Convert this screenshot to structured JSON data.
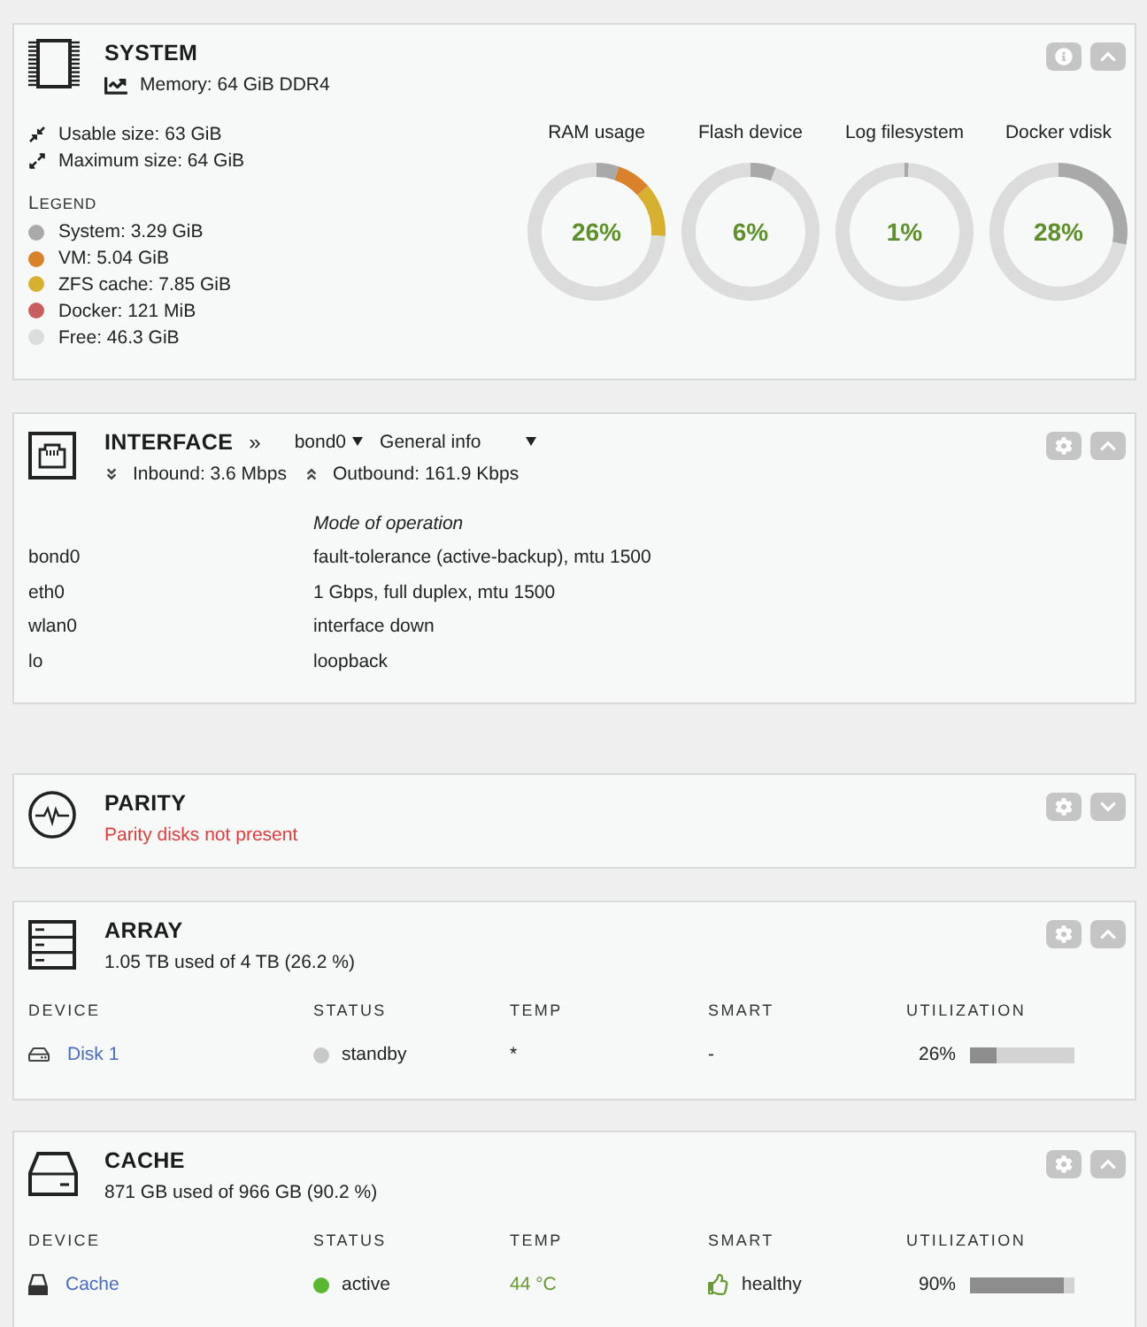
{
  "panels": [
    {
      "kind": "system",
      "title": "SYSTEM",
      "expanded": true,
      "memory": "Memory: 64 GiB DDR4",
      "sizes": [
        {
          "kind": "usable",
          "text": "Usable size: 63 GiB"
        },
        {
          "kind": "maximum",
          "text": "Maximum size: 64 GiB"
        }
      ],
      "legend": {
        "title": "LEGEND",
        "items": [
          {
            "label": "System: 3.29 GiB",
            "color": "#a9a9a9"
          },
          {
            "label": "VM: 5.04 GiB",
            "color": "#d9822b"
          },
          {
            "label": "ZFS cache: 7.85 GiB",
            "color": "#d6b02e"
          },
          {
            "label": "Docker: 121 MiB",
            "color": "#c85f5e"
          },
          {
            "label": "Free: 46.3 GiB",
            "color": "#dcdcdc"
          }
        ]
      },
      "gauges": [
        {
          "kind": "breakdown",
          "reading": "26%",
          "chart_data": {
            "type": "donut",
            "title": "RAM usage",
            "values": [
              5.3,
              8.1,
              12.6,
              74
            ]
          }
        },
        {
          "kind": "usage",
          "reading": "6%",
          "chart_data": {
            "type": "donut",
            "title": "Flash device",
            "values": [
              6,
              94
            ]
          }
        },
        {
          "kind": "usage",
          "reading": "1%",
          "chart_data": {
            "type": "donut",
            "title": "Log filesystem",
            "values": [
              1,
              99
            ]
          }
        },
        {
          "kind": "usage",
          "reading": "28%",
          "chart_data": {
            "type": "donut",
            "title": "Docker vdisk",
            "values": [
              28,
              72
            ]
          }
        }
      ]
    },
    {
      "kind": "interface",
      "title": "INTERFACE",
      "expanded": true,
      "separator": "»",
      "interface_select": "bond0",
      "view_select": "General info",
      "traffic": [
        {
          "kind": "inbound",
          "text": "Inbound: 3.6 Mbps"
        },
        {
          "kind": "outbound",
          "text": "Outbound: 161.9 Kbps"
        }
      ],
      "table": {
        "heading": "Mode of operation",
        "rows": [
          {
            "name": "bond0",
            "mode": "fault-tolerance (active-backup), mtu 1500"
          },
          {
            "name": "eth0",
            "mode": "1 Gbps, full duplex, mtu 1500"
          },
          {
            "name": "wlan0",
            "mode": "interface down"
          },
          {
            "name": "lo",
            "mode": "loopback"
          }
        ]
      }
    },
    {
      "kind": "parity",
      "title": "PARITY",
      "expanded": false,
      "status": "Parity disks not present"
    },
    {
      "kind": "array",
      "title": "ARRAY",
      "expanded": true,
      "usage": "1.05 TB used of 4 TB (26.2 %)",
      "table": {
        "columns": [
          "DEVICE",
          "STATUS",
          "TEMP",
          "SMART",
          "UTILIZATION"
        ],
        "rows": [
          {
            "device": {
              "name": "Disk 1",
              "kind": "hdd"
            },
            "status": {
              "text": "standby",
              "color": "#c8c8c8"
            },
            "temp": {
              "text": "*",
              "kind": "plain"
            },
            "smart": {
              "text": "-",
              "kind": "plain"
            },
            "utilization": {
              "reading": "26%",
              "level": 0.26
            }
          }
        ]
      }
    },
    {
      "kind": "cache",
      "title": "CACHE",
      "expanded": true,
      "usage": "871 GB used of 966 GB (90.2 %)",
      "table": {
        "columns": [
          "DEVICE",
          "STATUS",
          "TEMP",
          "SMART",
          "UTILIZATION"
        ],
        "rows": [
          {
            "device": {
              "name": "Cache",
              "kind": "ssd"
            },
            "status": {
              "text": "active",
              "color": "#58b830"
            },
            "temp": {
              "text": "44 °C",
              "kind": "normal"
            },
            "smart": {
              "text": "healthy",
              "kind": "healthy"
            },
            "utilization": {
              "reading": "90%",
              "level": 0.9
            }
          }
        ]
      }
    }
  ]
}
